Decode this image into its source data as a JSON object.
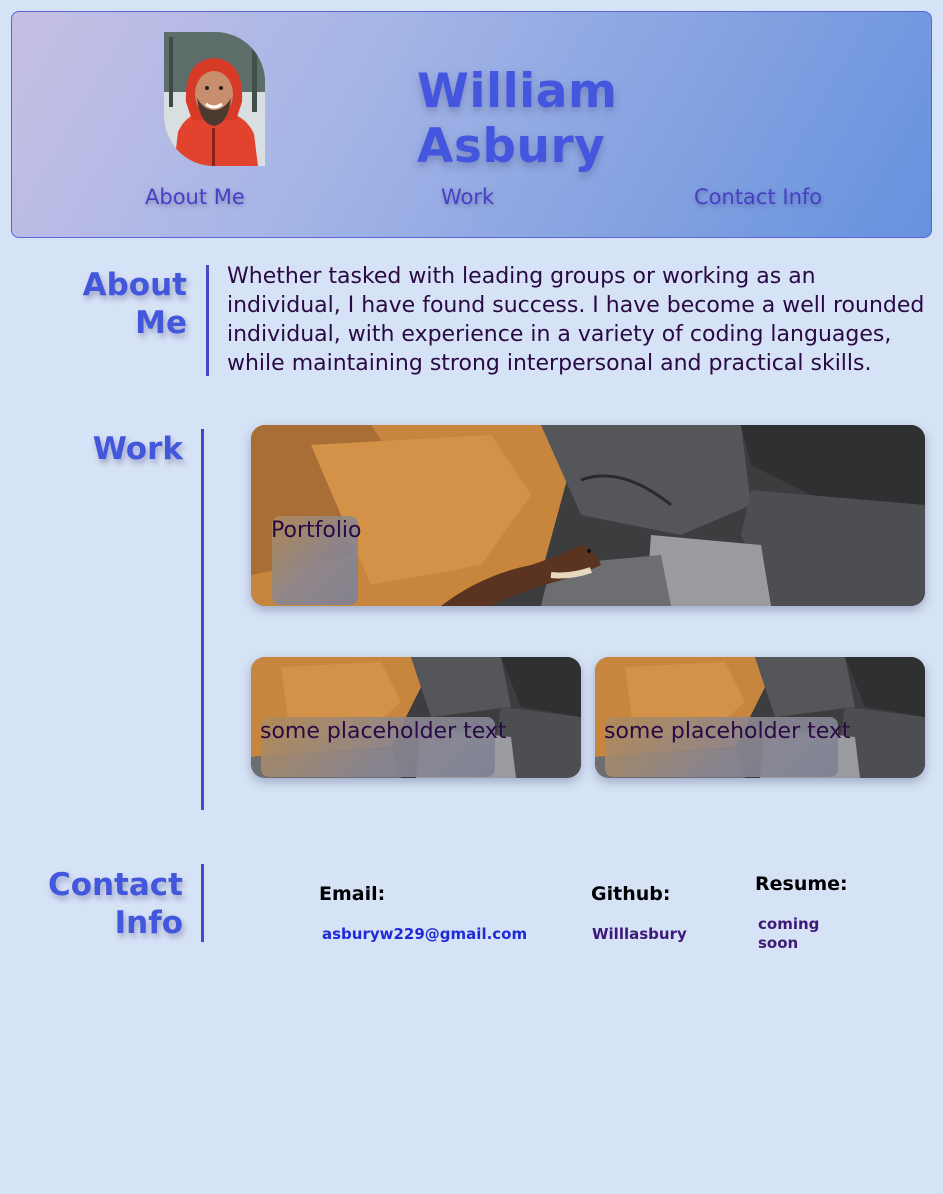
{
  "header": {
    "name": "William Asbury",
    "nav": [
      {
        "label": "About Me"
      },
      {
        "label": "Work"
      },
      {
        "label": "Contact Info"
      }
    ]
  },
  "about": {
    "heading": "About Me",
    "body": "Whether tasked with leading groups or working as an individual, I have found success. I have become a well rounded individual, with experience in a variety of coding languages, while maintaining strong interpersonal and practical skills."
  },
  "work": {
    "heading": "Work",
    "cards": [
      {
        "label": "Portfolio"
      },
      {
        "label": "some placeholder text"
      },
      {
        "label": "some placeholder text"
      }
    ]
  },
  "contact": {
    "heading_line1": "Contact",
    "heading_line2": "Info",
    "email_label": "Email:",
    "email_value": "asburyw229@gmail.com",
    "github_label": "Github:",
    "github_value": "Willlasbury",
    "resume_label": "Resume:",
    "resume_value_line1": "coming",
    "resume_value_line2": "soon"
  },
  "colors": {
    "page_bg": "#d6e2f5",
    "accent": "#4357dc",
    "text": "#2a0a45",
    "link": "#1f2bd6"
  }
}
